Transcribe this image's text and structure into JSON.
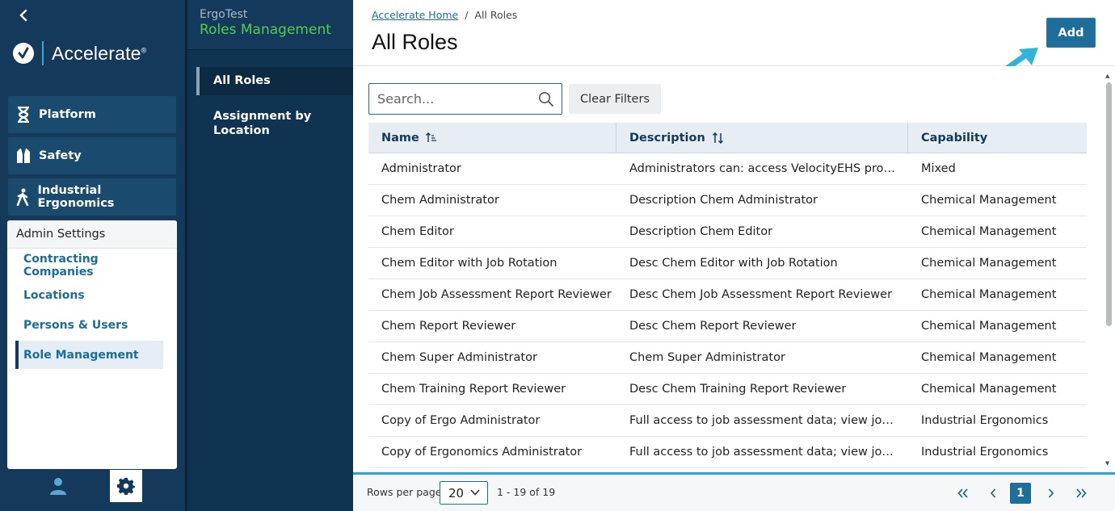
{
  "rail": {
    "brand": "Accelerate",
    "brand_mark": "®",
    "modules": [
      {
        "label": "Platform",
        "icon": "hourglass-icon"
      },
      {
        "label": "Safety",
        "icon": "vest-icon"
      },
      {
        "label": "Industrial Ergonomics",
        "icon": "walking-person-icon"
      }
    ],
    "admin": {
      "title": "Admin Settings",
      "links": [
        {
          "label": "Contracting Companies"
        },
        {
          "label": "Locations"
        },
        {
          "label": "Persons & Users"
        },
        {
          "label": "Role Management",
          "active": true
        }
      ]
    }
  },
  "subnav": {
    "app_name": "ErgoTest",
    "section_title": "Roles Management",
    "items": [
      {
        "label": "All Roles",
        "active": true
      },
      {
        "label": "Assignment by Location"
      }
    ]
  },
  "header": {
    "breadcrumb_home": "Accelerate Home",
    "breadcrumb_sep": "/",
    "breadcrumb_current": "All Roles",
    "title": "All Roles",
    "add_label": "Add"
  },
  "filters": {
    "search_placeholder": "Search...",
    "clear_label": "Clear Filters"
  },
  "table": {
    "columns": [
      "Name",
      "Description",
      "Capability"
    ],
    "rows": [
      {
        "name": "Administrator",
        "description": "Administrators can: access VelocityEHS products…",
        "capability": "Mixed"
      },
      {
        "name": "Chem Administrator",
        "description": "Description Chem Administrator",
        "capability": "Chemical Management"
      },
      {
        "name": "Chem Editor",
        "description": "Description Chem Editor",
        "capability": "Chemical Management"
      },
      {
        "name": "Chem Editor with Job Rotation",
        "description": "Desc Chem Editor with Job Rotation",
        "capability": "Chemical Management"
      },
      {
        "name": "Chem Job Assessment Report Reviewer",
        "description": "Desc Chem Job Assessment Report Reviewer",
        "capability": "Chemical Management"
      },
      {
        "name": "Chem Report Reviewer",
        "description": "Desc Chem Report Reviewer",
        "capability": "Chemical Management"
      },
      {
        "name": "Chem Super Administrator",
        "description": "Chem Super Administrator",
        "capability": "Chemical Management"
      },
      {
        "name": "Chem Training Report Reviewer",
        "description": "Desc Chem Training Report Reviewer",
        "capability": "Chemical Management"
      },
      {
        "name": "Copy of Ergo Administrator",
        "description": "Full access to job assessment data; view job asse…",
        "capability": "Industrial Ergonomics"
      },
      {
        "name": "Copy of Ergonomics Administrator",
        "description": "Full access to job assessment data; view job asse…",
        "capability": "Industrial Ergonomics"
      }
    ]
  },
  "pager": {
    "rows_label": "Rows per page",
    "rows_value": "20",
    "range": "1 - 19 of 19",
    "current_page": "1"
  },
  "colors": {
    "rail": "#14395a",
    "accent": "#1d6e9b",
    "subnav_title": "#4ed04e",
    "highlight_arrow": "#2fb4dc"
  }
}
